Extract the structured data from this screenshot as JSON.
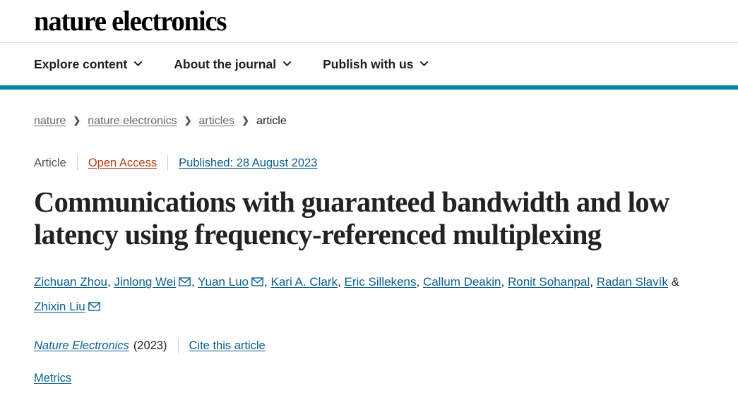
{
  "masthead": {
    "logo": "nature electronics"
  },
  "nav": {
    "items": [
      {
        "label": "Explore content",
        "icon": "chevron-down-icon"
      },
      {
        "label": "About the journal",
        "icon": "chevron-down-icon"
      },
      {
        "label": "Publish with us",
        "icon": "chevron-down-icon"
      }
    ],
    "accent_color": "#01899f"
  },
  "breadcrumb": {
    "separator": "❯",
    "items": [
      {
        "label": "nature",
        "link": true
      },
      {
        "label": "nature electronics",
        "link": true
      },
      {
        "label": "articles",
        "link": true
      },
      {
        "label": "article",
        "link": false
      }
    ]
  },
  "meta": {
    "type": "Article",
    "access": "Open Access",
    "access_color": "#b04014",
    "published": "Published: 28 August 2023",
    "link_color": "#0a5e8c"
  },
  "article": {
    "title": "Communications with guaranteed bandwidth and low latency using frequency-referenced multiplexing"
  },
  "authors": {
    "list": [
      {
        "name": "Zichuan Zhou",
        "mail": false
      },
      {
        "name": "Jinlong Wei",
        "mail": true
      },
      {
        "name": "Yuan Luo",
        "mail": true
      },
      {
        "name": "Kari A. Clark",
        "mail": false
      },
      {
        "name": "Eric Sillekens",
        "mail": false
      },
      {
        "name": "Callum Deakin",
        "mail": false
      },
      {
        "name": "Ronit Sohanpal",
        "mail": false
      },
      {
        "name": "Radan Slavík",
        "mail": false
      },
      {
        "name": "Zhixin Liu",
        "mail": true
      }
    ],
    "ampersand": "&",
    "comma": ",",
    "mail_icon": "envelope-icon"
  },
  "citation": {
    "journal": "Nature Electronics",
    "year": "(2023)",
    "cite_label": "Cite this article"
  },
  "metrics": {
    "label": "Metrics"
  }
}
